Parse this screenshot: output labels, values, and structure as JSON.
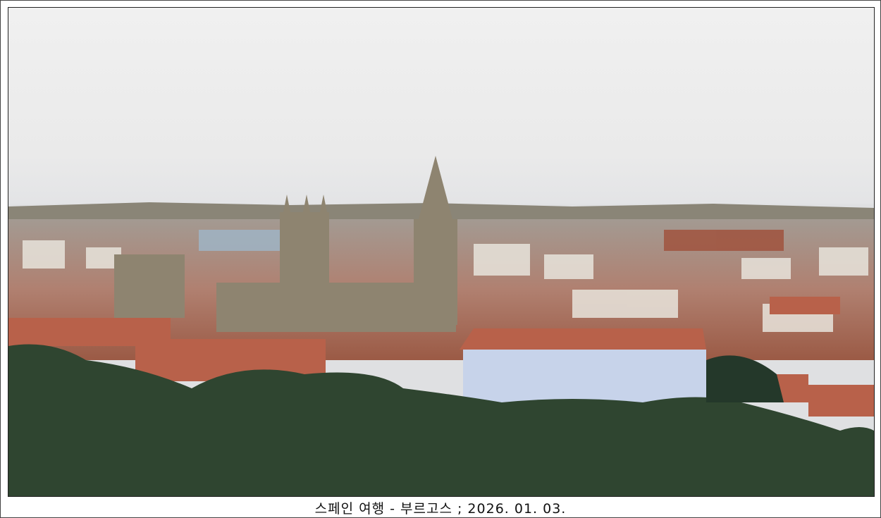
{
  "caption": "스페인 여행 - 부르고스 ; 2026. 01. 03.",
  "colors": {
    "sky": "#ececec",
    "roof": "#b8614a",
    "stone": "#8e8470",
    "tree": "#2f4530"
  }
}
